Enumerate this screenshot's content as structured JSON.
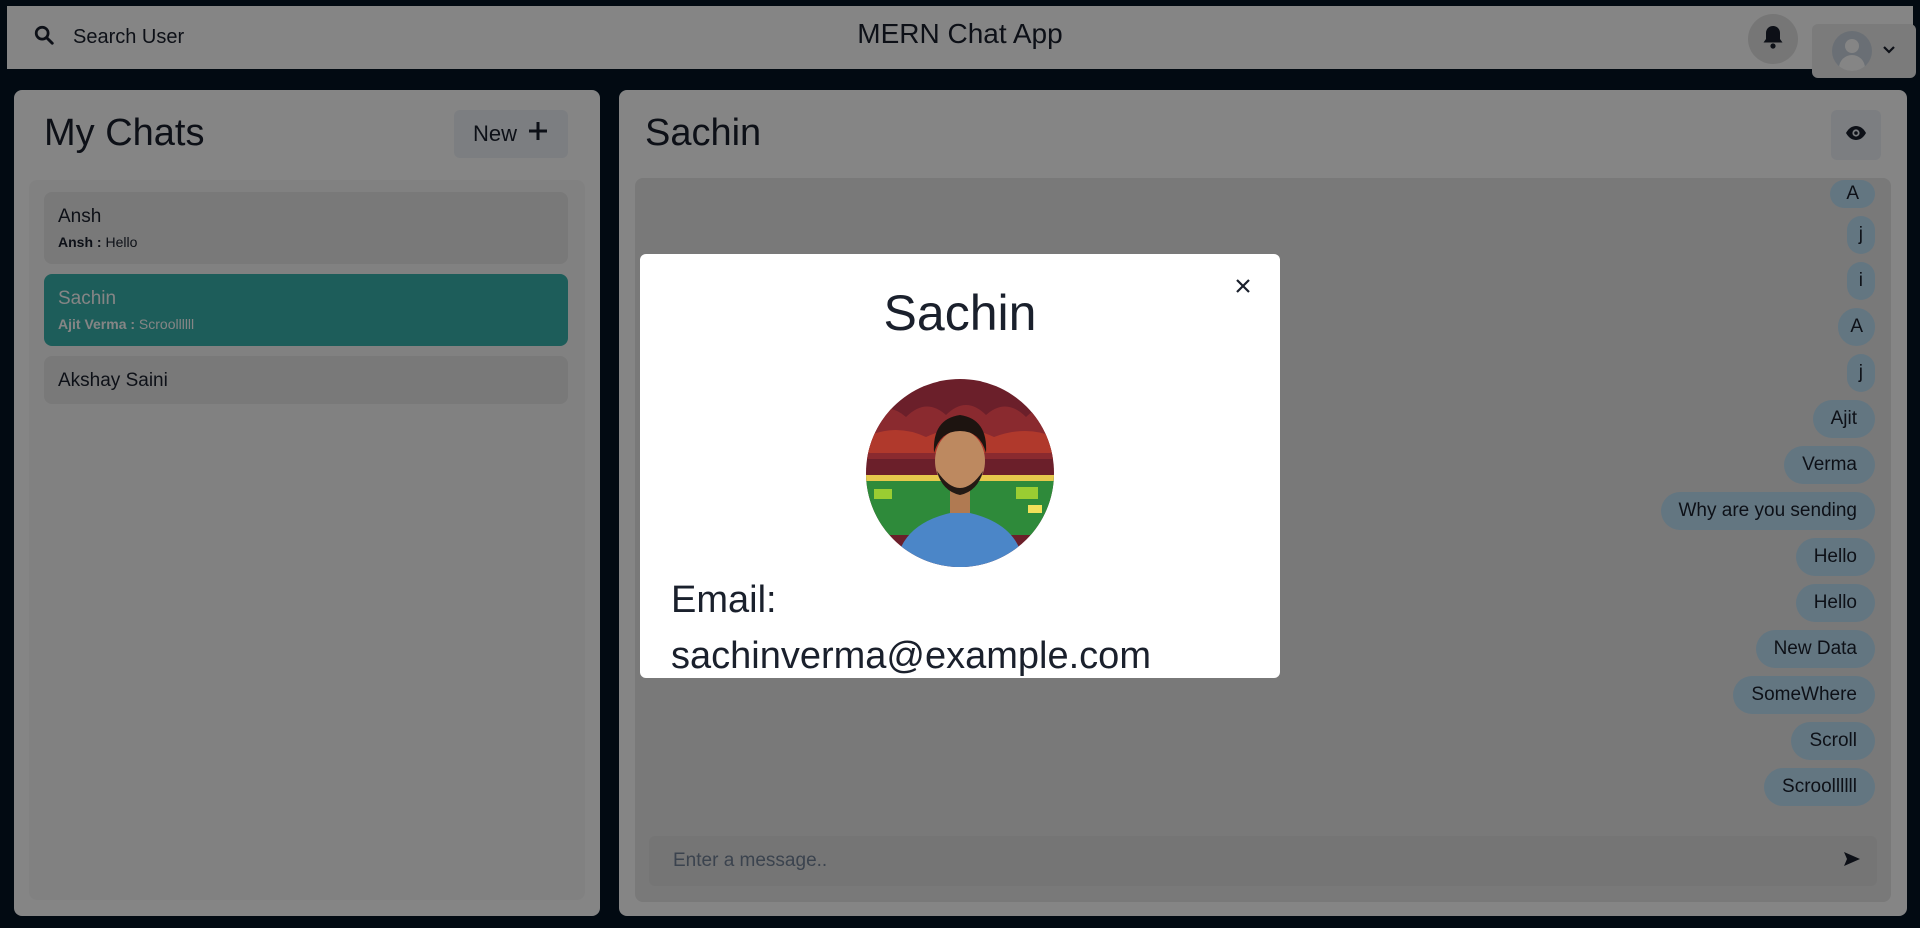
{
  "header": {
    "search_label": "Search User",
    "app_title": "MERN Chat App"
  },
  "sidebar": {
    "title": "My Chats",
    "new_group_label": "New",
    "chats": [
      {
        "name": "Ansh",
        "latest_sender": "Ansh :",
        "latest_text": "Hello",
        "active": false
      },
      {
        "name": "Sachin",
        "latest_sender": "Ajit Verma :",
        "latest_text": "Scroollllll",
        "active": true
      },
      {
        "name": "Akshay Saini",
        "active": false
      }
    ]
  },
  "chat": {
    "header_name": "Sachin",
    "messages": [
      "A",
      "j",
      "i",
      "A",
      "j",
      "Ajit",
      "Verma",
      "Why are you sending",
      "Hello",
      "Hello",
      "New Data",
      "SomeWhere",
      "Scroll",
      "Scroollllll"
    ],
    "input_placeholder": "Enter a message.."
  },
  "modal": {
    "title": "Sachin",
    "email_label": "Email:",
    "email_value": "sachinverma@example.com"
  },
  "colors": {
    "accent_teal": "#38b2ac",
    "bubble_blue": "#bee3f8",
    "page_background": "#051424"
  }
}
